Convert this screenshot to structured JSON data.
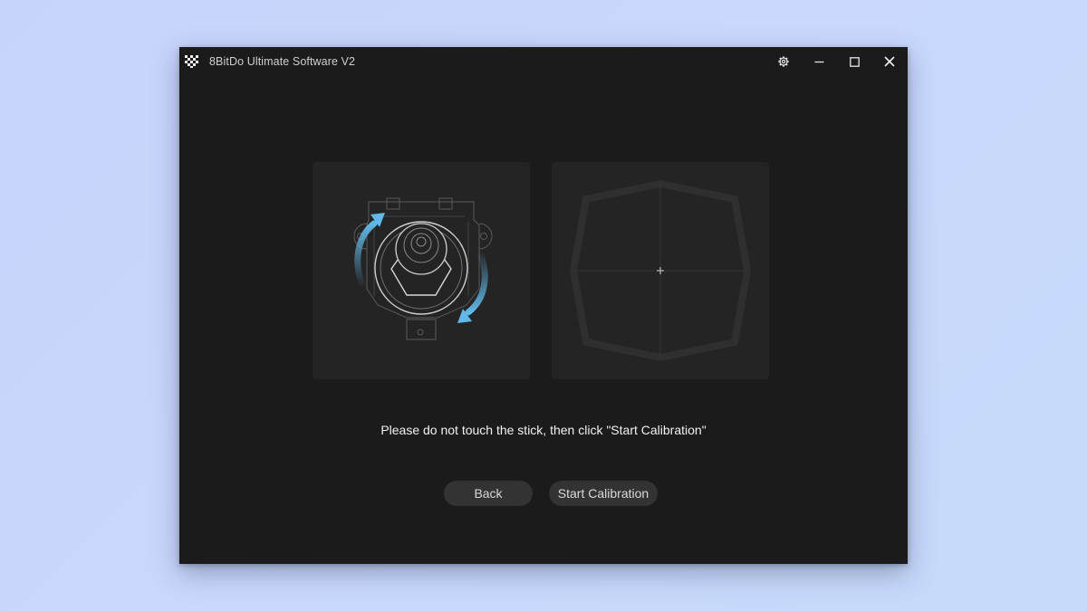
{
  "window": {
    "title": "8BitDo Ultimate Software V2"
  },
  "titlebar": {
    "icons": [
      "app-logo-icon",
      "gear-icon",
      "minimize-icon",
      "maximize-icon",
      "close-icon"
    ]
  },
  "calibration": {
    "instruction": "Please do not touch the stick, then click \"Start Calibration\"",
    "illustration": "joystick-rotate-icon",
    "range_display": "stick-range-octagon"
  },
  "buttons": {
    "back_label": "Back",
    "start_label": "Start Calibration"
  },
  "colors": {
    "accent_arrow": "#62b8e8",
    "window_bg": "#1b1b1b",
    "panel_bg": "#242424",
    "button_bg": "#333333"
  }
}
